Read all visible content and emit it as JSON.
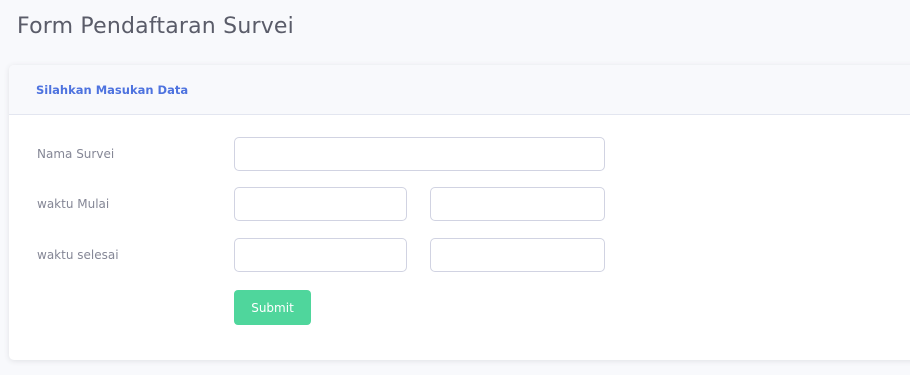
{
  "page": {
    "title": "Form Pendaftaran Survei"
  },
  "card": {
    "header": "Silahkan Masukan Data"
  },
  "form": {
    "nama_survei": {
      "label": "Nama Survei",
      "value": "",
      "placeholder": ""
    },
    "waktu_mulai": {
      "label": "waktu Mulai",
      "date_value": "",
      "time_value": ""
    },
    "waktu_selesai": {
      "label": "waktu selesai",
      "date_value": "",
      "time_value": ""
    },
    "submit_label": "Submit"
  },
  "colors": {
    "accent": "#4e73df",
    "submit": "#4fd69c",
    "text": "#858796",
    "background": "#f8f9fc"
  }
}
